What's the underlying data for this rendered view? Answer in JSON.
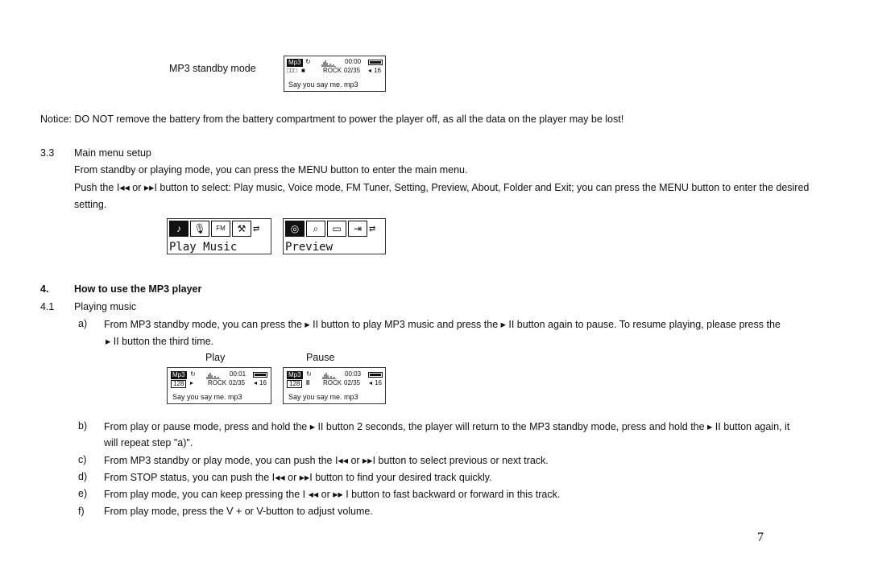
{
  "standby": {
    "label": "MP3 standby mode",
    "lcd": {
      "format": "Mp3",
      "eq_name": "ROCK",
      "time": "00:00",
      "track": "02/35",
      "volume": "16",
      "bitrate": "□□□",
      "state_icon": "■",
      "song": "Say you say me. mp3"
    }
  },
  "notice": "Notice: DO NOT remove the battery from the battery compartment   to power the player off, as all the data on the player may be lost!",
  "section_3_3": {
    "number": "3.3",
    "title": "Main menu setup",
    "para1": "From standby or playing mode, you can press the MENU button to enter the main menu.",
    "para2_line1": "Push the I◂◂ or ▸▸I button to select: Play music, Voice mode, FM Tuner, Setting, Preview, About, Folder and Exit; you can press the MENU button to enter the desired",
    "para2_line2": "setting.",
    "menu_screens": [
      {
        "label": "Play Music",
        "icons": [
          "music-note",
          "microphone",
          "FM",
          "settings"
        ],
        "arrow": "⇄"
      },
      {
        "label": "Preview",
        "icons": [
          "preview",
          "search-folder",
          "folder",
          "exit"
        ],
        "arrow": "⇄"
      }
    ],
    "icon_glyphs": {
      "music-note": "♪",
      "microphone": "🎙",
      "FM": "FM",
      "settings": "⚒",
      "preview": "◎",
      "search-folder": "⌕",
      "folder": "▭",
      "exit": "⇥"
    }
  },
  "section_4": {
    "number": "4.",
    "title": "How to use the MP3 player",
    "sub_number": "4.1",
    "sub_title": "Playing music",
    "items": [
      {
        "mark": "a)",
        "line1": "From MP3 standby mode, you can press the  ▸ II button to play MP3 music and press the  ▸ II  button again to pause. To resume playing, please press the",
        "line2": "▸ II button the third time."
      },
      {
        "mark": "b)",
        "line1": "From play or pause mode, press and hold the  ▸ II button 2 seconds, the player will return to the MP3 standby mode, press and hold the  ▸ II button again, it",
        "line2": "will repeat step \"a)\"."
      },
      {
        "mark": "c)",
        "line1": " From MP3 standby or play mode, you can push the I◂◂  or  ▸▸I button to select previous or next track."
      },
      {
        "mark": "d)",
        "line1": " From STOP status, you can push the I◂◂ or ▸▸I button to find your desired track quickly."
      },
      {
        "mark": "e)",
        "line1": " From play mode, you can keep pressing the I ◂◂ or  ▸▸ I button to fast backward or forward in this track."
      },
      {
        "mark": "f)",
        "line1": " From play mode, press the V + or V-button to adjust volume."
      }
    ],
    "screens": [
      {
        "caption": "Play",
        "format": "Mp3",
        "bitrate": "128",
        "state_icon": "▸",
        "eq_name": "ROCK",
        "time": "00:01",
        "track": "02/35",
        "volume": "16",
        "song": "Say you say me. mp3"
      },
      {
        "caption": "Pause",
        "format": "Mp3",
        "bitrate": "128",
        "state_icon": "II",
        "eq_name": "ROCK",
        "time": "00:03",
        "track": "02/35",
        "volume": "16",
        "song": "Say you say me. mp3"
      }
    ]
  },
  "page_number": "7"
}
